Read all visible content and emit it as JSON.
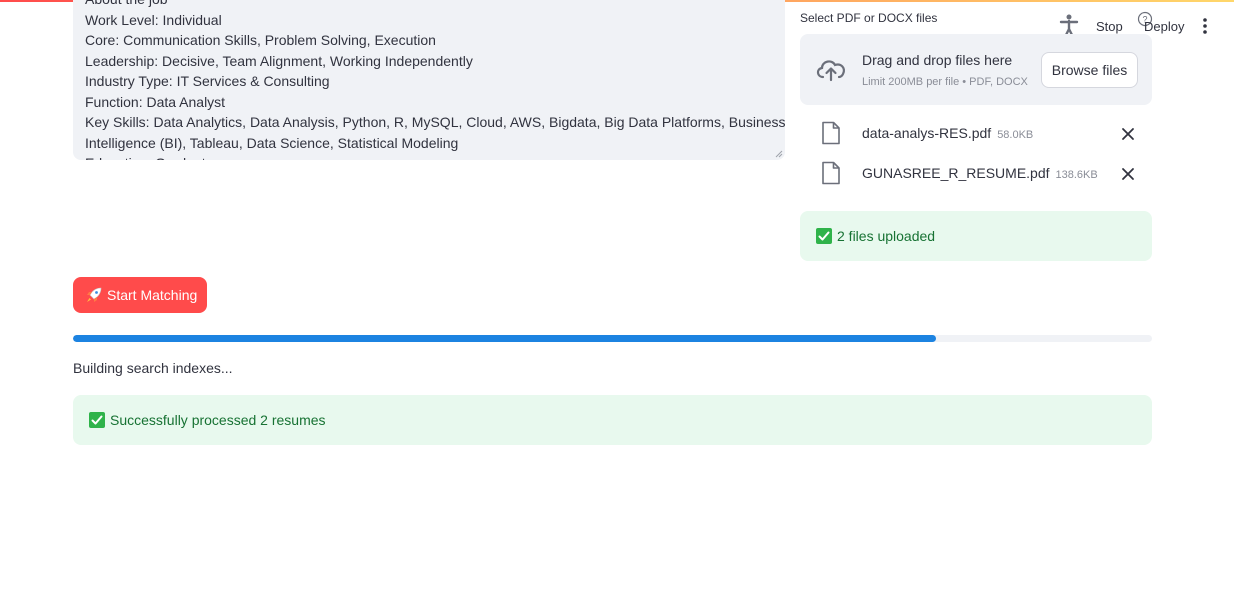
{
  "header": {
    "stop_label": "Stop",
    "deploy_label": "Deploy",
    "icons": [
      "running-man-icon",
      "help-icon",
      "more-menu-icon"
    ]
  },
  "job_description": {
    "lines": [
      "About the job",
      "Work Level: Individual",
      "Core: Communication Skills, Problem Solving, Execution",
      "Leadership: Decisive, Team Alignment, Working Independently",
      "Industry Type: IT Services & Consulting",
      "Function: Data Analyst",
      "Key Skills: Data Analytics, Data Analysis, Python, R, MySQL, Cloud, AWS, Bigdata, Big Data Platforms, Business",
      "Intelligence (BI), Tableau, Data Science, Statistical Modeling",
      "Education: Graduate"
    ]
  },
  "uploader": {
    "label": "Select PDF or DOCX files",
    "drop_title": "Drag and drop files here",
    "limit_text": "Limit 200MB per file • PDF, DOCX",
    "browse_label": "Browse files",
    "files": [
      {
        "name": "data-analys-RES.pdf",
        "size": "58.0KB"
      },
      {
        "name": "GUNASREE_R_RESUME.pdf",
        "size": "138.6KB"
      }
    ],
    "uploaded_message": "2 files uploaded"
  },
  "actions": {
    "start_label": "Start Matching"
  },
  "progress": {
    "fraction": 0.8,
    "status_text": "Building search indexes..."
  },
  "result": {
    "success_message": "Successfully processed 2 resumes"
  },
  "colors": {
    "primary": "#ff4b4b",
    "progress": "#1c83e1",
    "success_bg": "#e8f9ee",
    "success_text": "#177233"
  }
}
